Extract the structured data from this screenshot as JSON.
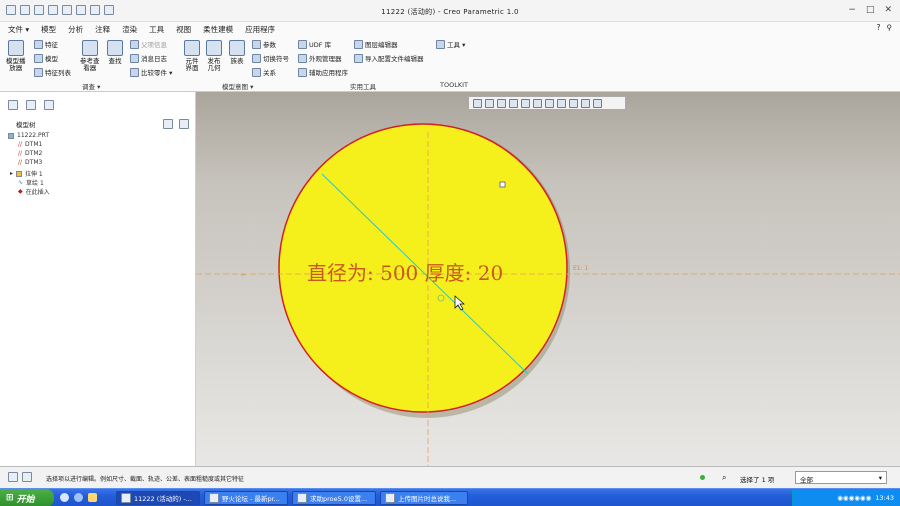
{
  "window": {
    "title": "11222 (活动的) - Creo Parametric 1.0"
  },
  "menu": [
    "文件 ▾",
    "模型",
    "分析",
    "注释",
    "渲染",
    "工具",
    "视图",
    "柔性建模",
    "应用程序"
  ],
  "ribbon": {
    "regen": {
      "big1": "模型播\n放器",
      "items": [
        "特征",
        "模型",
        "特征列表"
      ]
    },
    "investigate": {
      "big1": "参考查\n看器",
      "big2": "查找",
      "items": [
        "父项信息",
        "消息日志",
        "比较零件 ▾"
      ]
    },
    "model_intent": {
      "big1": "元件\n界面",
      "big2": "发布\n几何",
      "big3": "族表",
      "items": [
        "参数",
        "切换符号",
        "关系"
      ]
    },
    "utilities": {
      "items": [
        "UDF 库",
        "外观管理器",
        "辅助应用程序",
        "图层编辑器",
        "导入配置文件编辑器"
      ]
    },
    "toolkit": {
      "items": [
        "工具 ▾"
      ]
    },
    "groups": {
      "investigate": "调查 ▾",
      "model_intent": "模型意图 ▾",
      "utilities": "实用工具",
      "toolkit": "TOOLKIT"
    }
  },
  "tree": {
    "title": "模型树",
    "items": [
      {
        "label": "11222.PRT"
      },
      {
        "label": "DTM1"
      },
      {
        "label": "DTM2"
      },
      {
        "label": "DTM3"
      },
      {
        "label": "拉伸 1"
      },
      {
        "label": "草绘 1"
      },
      {
        "label": "在此插入"
      }
    ]
  },
  "viewport": {
    "annotation": "直径为: 500 厚度: 20",
    "leader_tag": "E1: 1",
    "fill_color": "#f5f01c",
    "edge_color": "#d42020"
  },
  "status": {
    "message": "选择项以进行编辑。例如尺寸、截面、轨迹、公差、表面粗糙度或其它特征",
    "selected": "选择了 1 项",
    "filter": "全部"
  },
  "taskbar": {
    "start": "开始",
    "tasks": [
      "11222 (活动的) -...",
      "野火论坛 - 最新pr...",
      "求助proe5.0设置...",
      "上传图片时总说我..."
    ],
    "time": "13:43"
  },
  "colors": {
    "accent": "#245edb"
  }
}
